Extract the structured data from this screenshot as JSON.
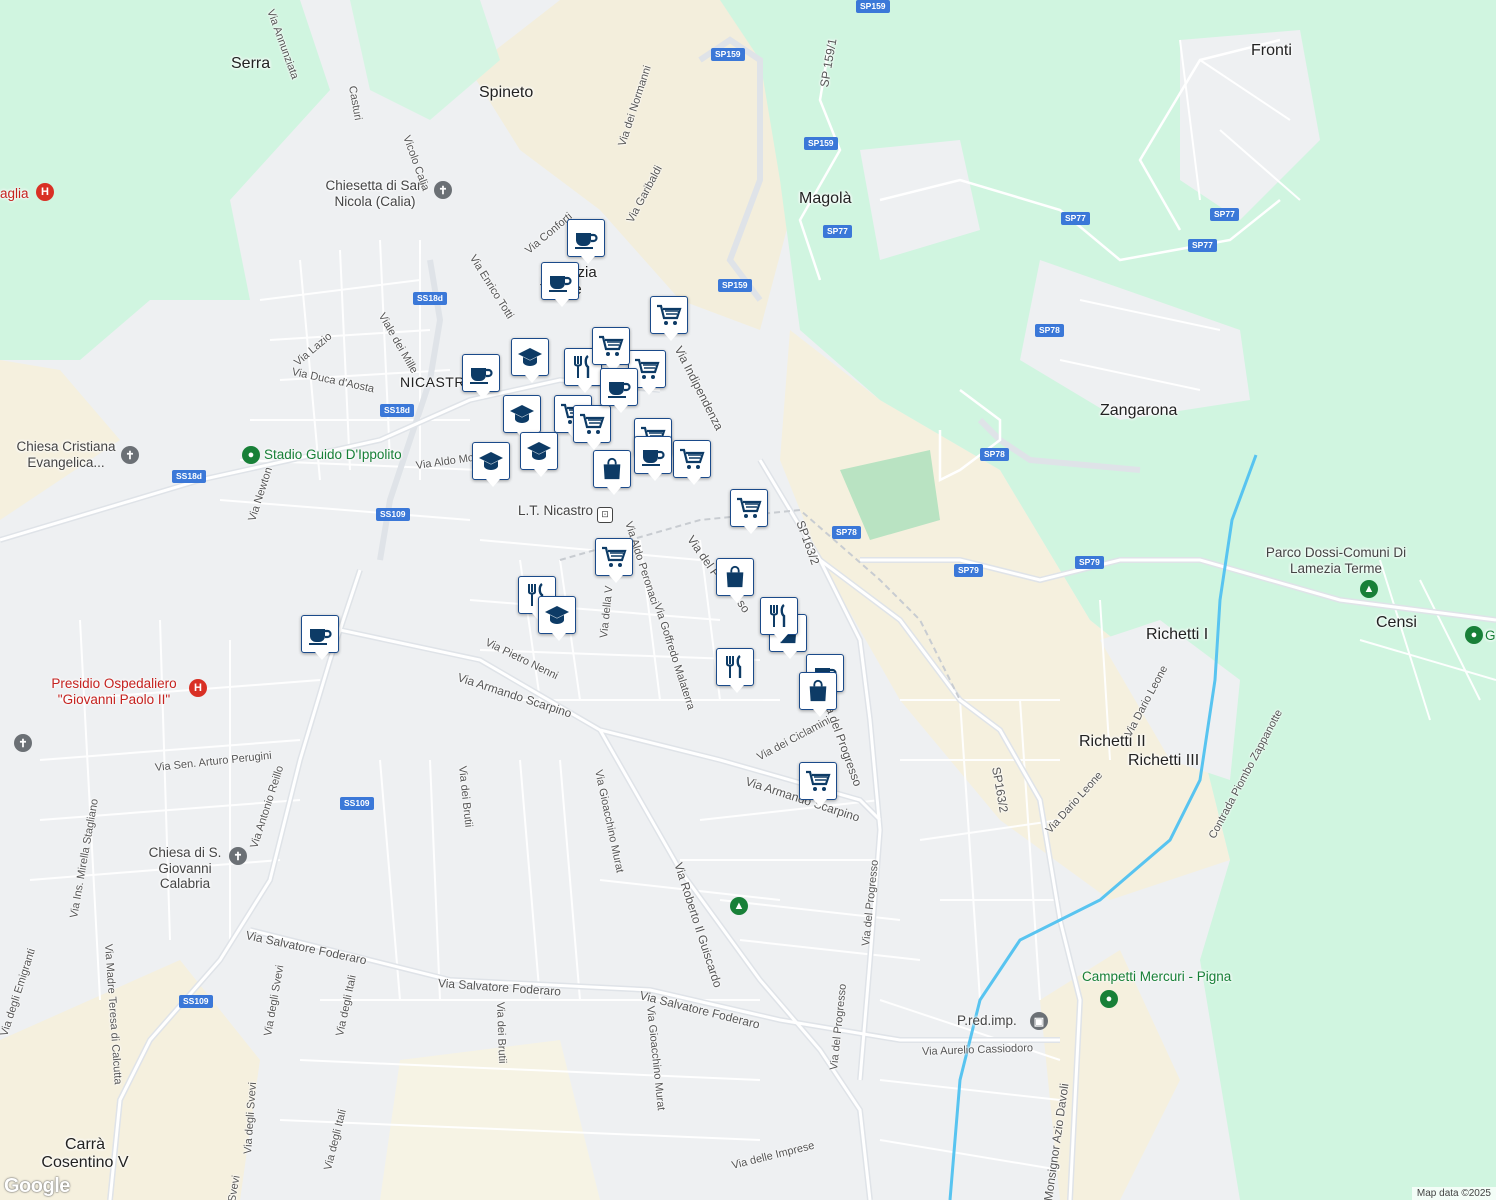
{
  "map": {
    "colors": {
      "water": "#58c4f0",
      "park": "#d0f5e0",
      "urban": "#eef0f2",
      "rural": "#f5f0de",
      "road": "#ffffff",
      "marker_bg": "#ffffff",
      "marker_icon": "#0d3b66",
      "hospital": "#d93025",
      "nature": "#188038"
    },
    "places": [
      {
        "id": "serra",
        "text": "Serra"
      },
      {
        "id": "spineto",
        "text": "Spineto"
      },
      {
        "id": "magola",
        "text": "Magolà"
      },
      {
        "id": "fronti",
        "text": "Fronti"
      },
      {
        "id": "zangarona",
        "text": "Zangarona"
      },
      {
        "id": "nicastro",
        "text": "NICASTRO"
      },
      {
        "id": "lamezia",
        "text": "Lamezia Terme"
      },
      {
        "id": "richetti1",
        "text": "Richetti I"
      },
      {
        "id": "richetti2",
        "text": "Richetti II"
      },
      {
        "id": "richetti3",
        "text": "Richetti III"
      },
      {
        "id": "censi",
        "text": "Censi"
      },
      {
        "id": "carra",
        "text": "Carrà Cosentino V"
      }
    ],
    "pois": [
      {
        "id": "chiesetta",
        "text": "Chiesetta di San Nicola (Calia)",
        "icon": "cross-icon"
      },
      {
        "id": "chiesa-cristiana",
        "text": "Chiesa Cristiana Evangelica...",
        "icon": "cross-icon"
      },
      {
        "id": "stadio",
        "text": "Stadio Guido D'Ippolito",
        "icon": "stadium-icon"
      },
      {
        "id": "lt-nicastro",
        "text": "L.T. Nicastro",
        "icon": "bus-icon"
      },
      {
        "id": "presidio",
        "text": "Presidio Ospedaliero \"Giovanni Paolo II\"",
        "icon": "hospital-icon"
      },
      {
        "id": "chiesa-sgiovanni",
        "text": "Chiesa di S. Giovanni Calabria",
        "icon": "cross-icon"
      },
      {
        "id": "parco-dossi",
        "text": "Parco Dossi-Comuni Di Lamezia Terme",
        "icon": "tree-icon"
      },
      {
        "id": "campetti",
        "text": "Campetti Mercuri - Pigna",
        "icon": "sports-icon"
      },
      {
        "id": "pred",
        "text": "P.red.imp.",
        "icon": "building-icon"
      },
      {
        "id": "aglia",
        "text": "aglia",
        "icon": "hospital-icon"
      },
      {
        "id": "g-edge",
        "text": "G",
        "icon": "sports-icon"
      }
    ],
    "roads": [
      {
        "id": "annunziata",
        "text": "Via Annunziata"
      },
      {
        "id": "casturi",
        "text": "Casturi"
      },
      {
        "id": "vicolo-calia",
        "text": "Vicolo Calia"
      },
      {
        "id": "normanni",
        "text": "Via dei Normanni"
      },
      {
        "id": "garibaldi",
        "text": "Via Garibaldi"
      },
      {
        "id": "conforti",
        "text": "Via Conforti"
      },
      {
        "id": "totti",
        "text": "Via Enrico Totti"
      },
      {
        "id": "lazio",
        "text": "Via Lazio"
      },
      {
        "id": "mille",
        "text": "Viale dei Mille"
      },
      {
        "id": "duca",
        "text": "Via Duca d'Aosta"
      },
      {
        "id": "indipendenza",
        "text": "Via Indipendenza"
      },
      {
        "id": "aldo-moro",
        "text": "Via Aldo Mo"
      },
      {
        "id": "newton",
        "text": "Via Newton"
      },
      {
        "id": "via-del-p",
        "text": "Via del P"
      },
      {
        "id": "so",
        "text": "so"
      },
      {
        "id": "peronaci",
        "text": "Via Aldo Peronaci"
      },
      {
        "id": "malaterra",
        "text": "Via Goffredo Malaterra"
      },
      {
        "id": "della-v",
        "text": "Via della V"
      },
      {
        "id": "nenni",
        "text": "Via Pietro Nenni"
      },
      {
        "id": "scarpino",
        "text": "Via Armando Scarpino"
      },
      {
        "id": "scarpino2",
        "text": "Via Armando Scarpino"
      },
      {
        "id": "perugini",
        "text": "Via Sen. Arturo Perugini"
      },
      {
        "id": "reillo",
        "text": "Via Antonio Reillo"
      },
      {
        "id": "brutii",
        "text": "Via dei Brutii"
      },
      {
        "id": "brutii2",
        "text": "Via dei Brutii"
      },
      {
        "id": "murat",
        "text": "Via Gioacchino Murat"
      },
      {
        "id": "murat2",
        "text": "Via Gioacchino Murat"
      },
      {
        "id": "guiscardo",
        "text": "Via Roberto Il Guiscardo"
      },
      {
        "id": "ciclamini",
        "text": "Via dei Ciclamini"
      },
      {
        "id": "progresso1",
        "text": "Via del Progresso"
      },
      {
        "id": "progresso2",
        "text": "Via del Progresso"
      },
      {
        "id": "progresso3",
        "text": "Via del Progresso"
      },
      {
        "id": "sp163",
        "text": "SP163/2"
      },
      {
        "id": "sp163b",
        "text": "SP163/2"
      },
      {
        "id": "sp1591",
        "text": "SP 159/1"
      },
      {
        "id": "dario1",
        "text": "Via Dario Leone"
      },
      {
        "id": "dario2",
        "text": "Via Dario Leone"
      },
      {
        "id": "piombo",
        "text": "Contrada Piombo Zappanotte"
      },
      {
        "id": "stagliano",
        "text": "Via Ins. Mirella Stagliano"
      },
      {
        "id": "teresa",
        "text": "Via Madre Teresa di Calcutta"
      },
      {
        "id": "emigranti",
        "text": "Via degli Emigranti"
      },
      {
        "id": "foderaro1",
        "text": "Via Salvatore Foderaro"
      },
      {
        "id": "foderaro2",
        "text": "Via Salvatore Foderaro"
      },
      {
        "id": "foderaro3",
        "text": "Via Salvatore Foderaro"
      },
      {
        "id": "svevi1",
        "text": "Via degli Svevi"
      },
      {
        "id": "svevi2",
        "text": "Via degli Svevi"
      },
      {
        "id": "svevi3",
        "text": "Svevi"
      },
      {
        "id": "itali1",
        "text": "Via degli Itali"
      },
      {
        "id": "itali2",
        "text": "Via degli Itali"
      },
      {
        "id": "cassiodoro",
        "text": "Via Aurelio Cassiodoro"
      },
      {
        "id": "imprese",
        "text": "Via delle Imprese"
      },
      {
        "id": "davoli",
        "text": "Monsignor Azio Davoli"
      }
    ],
    "shields": [
      {
        "id": "sp159a",
        "text": "SP159"
      },
      {
        "id": "sp159b",
        "text": "SP159"
      },
      {
        "id": "sp159c",
        "text": "SP159"
      },
      {
        "id": "sp159d",
        "text": "SP159"
      },
      {
        "id": "sp77a",
        "text": "SP77"
      },
      {
        "id": "sp77b",
        "text": "SP77"
      },
      {
        "id": "sp77c",
        "text": "SP77"
      },
      {
        "id": "sp77d",
        "text": "SP77"
      },
      {
        "id": "sp78a",
        "text": "SP78"
      },
      {
        "id": "sp78b",
        "text": "SP78"
      },
      {
        "id": "sp78c",
        "text": "SP78"
      },
      {
        "id": "sp79a",
        "text": "SP79"
      },
      {
        "id": "sp79b",
        "text": "SP79"
      },
      {
        "id": "ss18d1",
        "text": "SS18d"
      },
      {
        "id": "ss18d2",
        "text": "SS18d"
      },
      {
        "id": "ss18d3",
        "text": "SS18d"
      },
      {
        "id": "ss109a",
        "text": "SS109"
      },
      {
        "id": "ss109b",
        "text": "SS109"
      },
      {
        "id": "ss109c",
        "text": "SS109"
      }
    ],
    "markers": [
      {
        "type": "cafe"
      },
      {
        "type": "cafe"
      },
      {
        "type": "grocery"
      },
      {
        "type": "education"
      },
      {
        "type": "restaurant"
      },
      {
        "type": "grocery"
      },
      {
        "type": "grocery"
      },
      {
        "type": "cafe"
      },
      {
        "type": "education"
      },
      {
        "type": "grocery"
      },
      {
        "type": "grocery"
      },
      {
        "type": "education"
      },
      {
        "type": "education"
      },
      {
        "type": "grocery"
      },
      {
        "type": "cafe"
      },
      {
        "type": "grocery"
      },
      {
        "type": "shopping"
      },
      {
        "type": "grocery"
      },
      {
        "type": "grocery"
      },
      {
        "type": "restaurant"
      },
      {
        "type": "education"
      },
      {
        "type": "cafe"
      },
      {
        "type": "shopping"
      },
      {
        "type": "restaurant"
      },
      {
        "type": "shopping"
      },
      {
        "type": "restaurant"
      },
      {
        "type": "cafe"
      },
      {
        "type": "shopping"
      },
      {
        "type": "grocery"
      },
      {
        "type": "cafe"
      }
    ],
    "logo": "Google",
    "attribution": "Map data ©2025"
  }
}
